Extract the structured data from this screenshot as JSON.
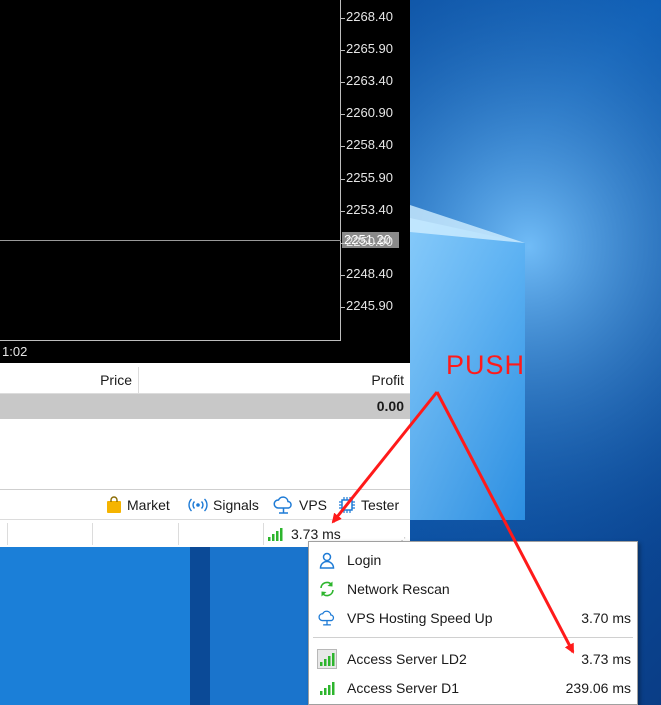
{
  "chart": {
    "price_ticks": [
      "2268.40",
      "2265.90",
      "2263.40",
      "2260.90",
      "2258.40",
      "2255.90",
      "2253.40",
      "2250.90",
      "2248.40",
      "2245.90"
    ],
    "current_price": "2251.20",
    "time_label": "1:02"
  },
  "table": {
    "price_header": "Price",
    "profit_header": "Profit",
    "total_profit": "0.00"
  },
  "tabs": [
    {
      "label": "Market",
      "icon": "shopping-bag-icon"
    },
    {
      "label": "Signals",
      "icon": "signal-broadcast-icon"
    },
    {
      "label": "VPS",
      "icon": "cloud-icon"
    },
    {
      "label": "Tester",
      "icon": "chip-icon"
    }
  ],
  "status": {
    "ping": "3.73 ms",
    "signal_icon": "signal-bars-icon"
  },
  "menu": {
    "items": [
      {
        "label": "Login",
        "value": "",
        "icon": "user-icon"
      },
      {
        "label": "Network Rescan",
        "value": "",
        "icon": "refresh-icon"
      },
      {
        "label": "VPS Hosting Speed Up",
        "value": "3.70 ms",
        "icon": "cloud-icon"
      },
      {
        "label": "Access Server LD2",
        "value": "3.73 ms",
        "icon": "signal-bars-icon"
      },
      {
        "label": "Access Server D1",
        "value": "239.06 ms",
        "icon": "signal-bars-icon"
      }
    ]
  },
  "annotation": {
    "label": "PUSH",
    "color": "#ff1a1a"
  },
  "colors": {
    "signal_green": "#2db52d",
    "accent_blue": "#1e7bd6",
    "desktop_blue": "#0a4f9e"
  }
}
